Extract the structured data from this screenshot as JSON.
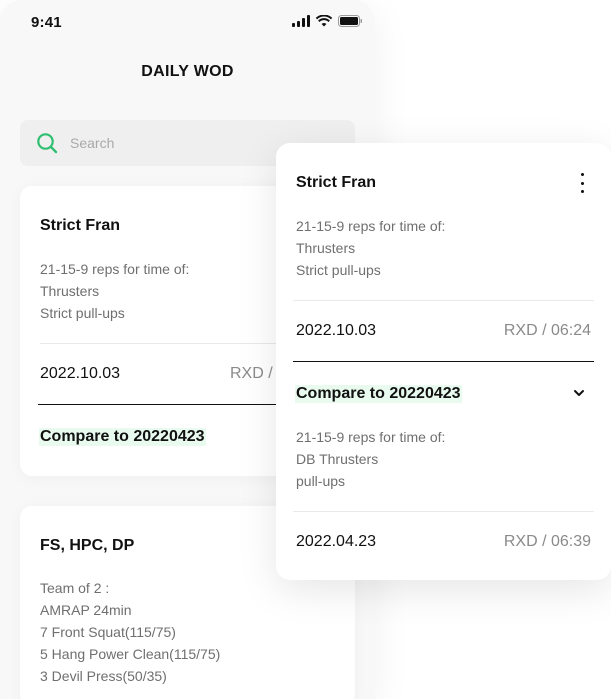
{
  "status_bar": {
    "time": "9:41"
  },
  "header": {
    "title": "DAILY WOD"
  },
  "search": {
    "placeholder": "Search"
  },
  "cards": [
    {
      "title": "Strict Fran",
      "description": [
        "21-15-9 reps for time of:",
        "Thrusters",
        "Strict pull-ups"
      ],
      "date": "2022.10.03",
      "result": "RXD / 0",
      "compare_label": "Compare to 20220423"
    },
    {
      "title": "FS, HPC, DP",
      "description": [
        "Team of 2 :",
        "AMRAP 24min",
        "7 Front Squat(115/75)",
        "5 Hang Power Clean(115/75)",
        "3 Devil Press(50/35)"
      ]
    }
  ],
  "detail": {
    "title": "Strict Fran",
    "description": [
      "21-15-9 reps for time of:",
      "Thrusters",
      "Strict pull-ups"
    ],
    "date": "2022.10.03",
    "result": "RXD / 06:24",
    "compare_label": "Compare to 20220423",
    "compare_description": [
      "21-15-9 reps for time of:",
      "DB Thrusters",
      "pull-ups"
    ],
    "compare_date": "2022.04.23",
    "compare_result": "RXD / 06:39"
  },
  "colors": {
    "accent": "#2fbf71",
    "highlight": "#e9fbef",
    "text": "#111111",
    "muted": "#6f6f6f"
  },
  "icons": {
    "search": "search-icon",
    "more": "more-vertical-icon",
    "expand": "chevron-down-icon"
  }
}
